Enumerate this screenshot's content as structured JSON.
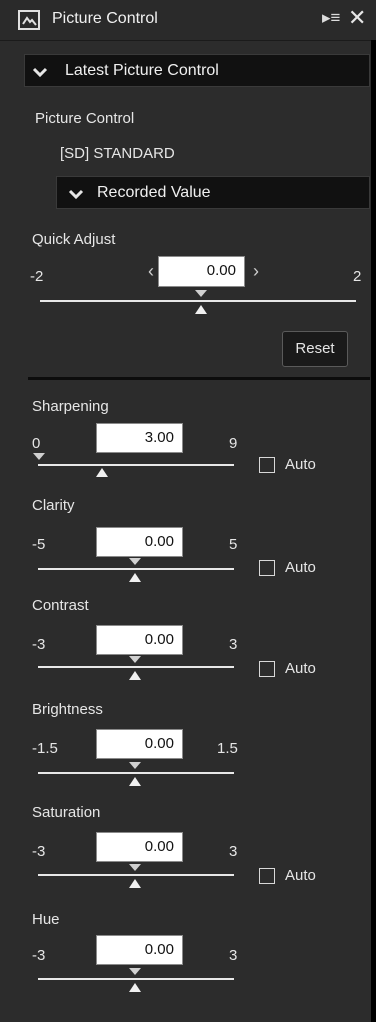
{
  "panel": {
    "title": "Picture Control",
    "menu_icon": "▸≡",
    "close_icon": "✕",
    "preset_dropdown": "Latest Picture Control"
  },
  "picture_control": {
    "heading": "Picture Control",
    "value": "[SD] STANDARD",
    "recorded_dropdown": "Recorded Value"
  },
  "quick_adjust": {
    "label": "Quick Adjust",
    "min": "-2",
    "max": "2",
    "value": "0.00",
    "reset_label": "Reset"
  },
  "adjustments": [
    {
      "label": "Sharpening",
      "min": "0",
      "max": "9",
      "value": "3.00",
      "auto": "Auto"
    },
    {
      "label": "Clarity",
      "min": "-5",
      "max": "5",
      "value": "0.00",
      "auto": "Auto"
    },
    {
      "label": "Contrast",
      "min": "-3",
      "max": "3",
      "value": "0.00",
      "auto": "Auto"
    },
    {
      "label": "Brightness",
      "min": "-1.5",
      "max": "1.5",
      "value": "0.00"
    },
    {
      "label": "Saturation",
      "min": "-3",
      "max": "3",
      "value": "0.00",
      "auto": "Auto"
    },
    {
      "label": "Hue",
      "min": "-3",
      "max": "3",
      "value": "0.00"
    }
  ],
  "colors": {
    "panel_bg": "#2c2c2c",
    "dropdown_bg": "#111111",
    "input_bg": "#ffffff",
    "text": "#e6e6e6"
  }
}
